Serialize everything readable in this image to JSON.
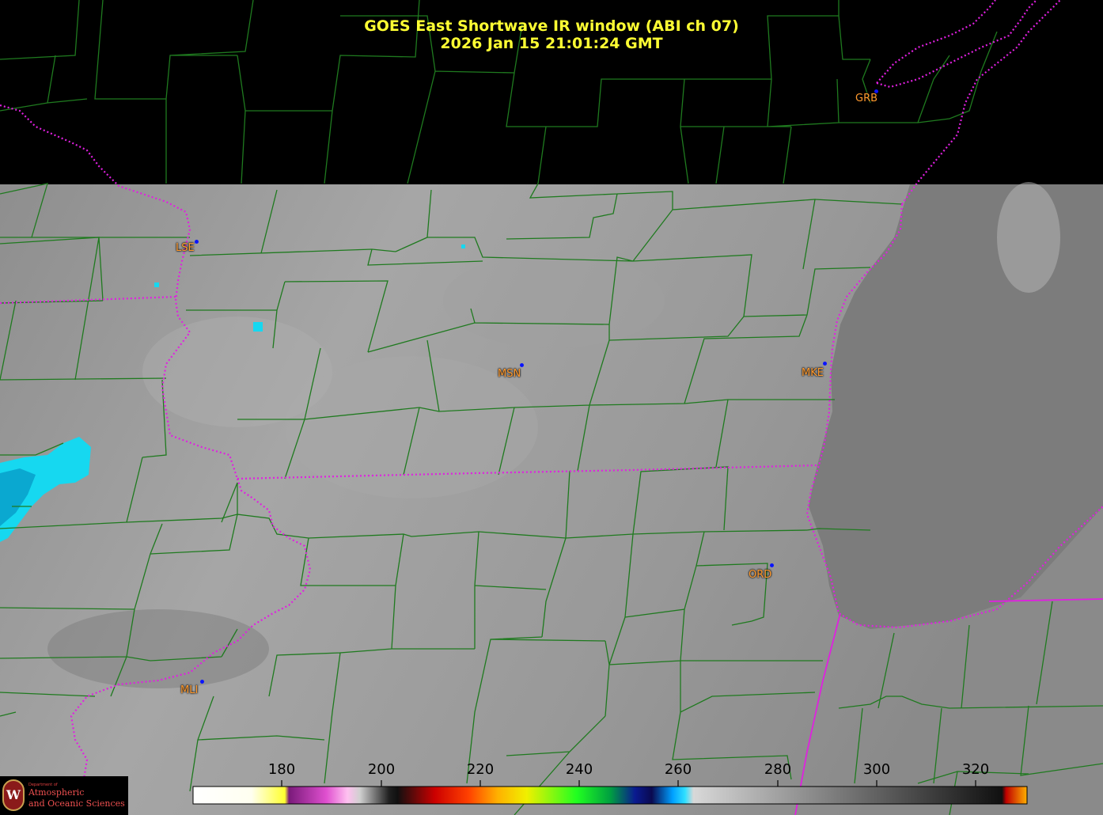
{
  "title": {
    "line1": "GOES East Shortwave IR window (ABI ch 07)",
    "line2": "2026 Jan 15  21:01:24 GMT"
  },
  "cities": [
    {
      "code": "GRB"
    },
    {
      "code": "LSE"
    },
    {
      "code": "MSN"
    },
    {
      "code": "MKE"
    },
    {
      "code": "ORD"
    },
    {
      "code": "MLI"
    }
  ],
  "colorbar": {
    "ticks": [
      "180",
      "200",
      "220",
      "240",
      "260",
      "280",
      "300",
      "320"
    ]
  },
  "logo": {
    "emblem": "W",
    "dept_line": "Department of",
    "line1": "Atmospheric",
    "line2": "and Oceanic Sciences"
  },
  "colors": {
    "title": "#ffff33",
    "city_label": "#ff9a2e",
    "county_lines": "#1f7a1f",
    "state_lines": "#e020e0",
    "cold_cloud": "#16d8f0"
  }
}
